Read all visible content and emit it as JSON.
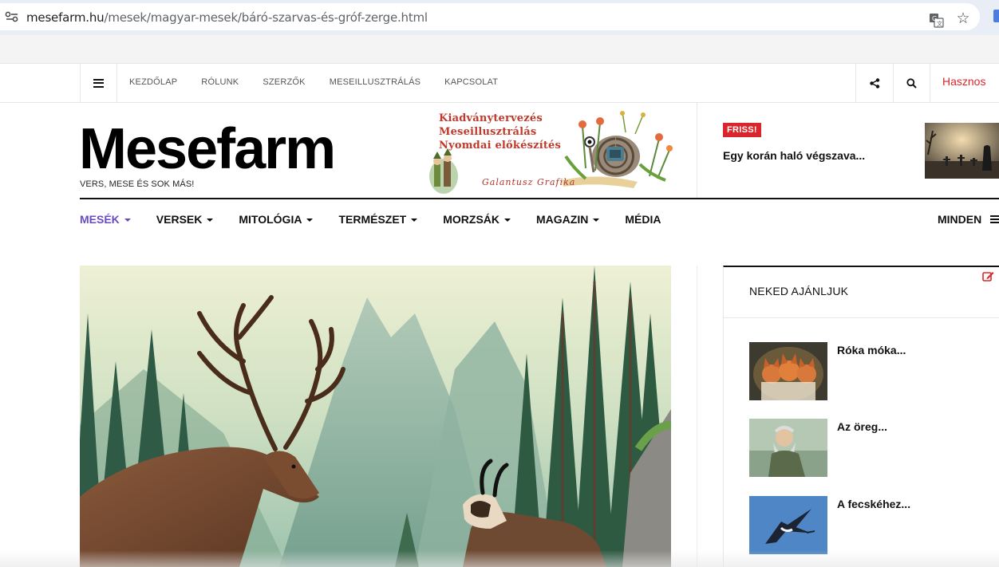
{
  "browser": {
    "url_host": "mesefarm.hu",
    "url_path": "/mesek/magyar-mesek/báró-szarvas-és-gróf-zerge.html",
    "icons": [
      "site-settings-icon",
      "translate-icon",
      "bookmark-star-icon"
    ]
  },
  "topnav": {
    "links": [
      "KEZDŐLAP",
      "RÓLUNK",
      "SZERZŐK",
      "MESEILLUSZTRÁLÁS",
      "KAPCSOLAT"
    ],
    "extra_link": "Hasznos",
    "icons": [
      "menu-icon",
      "share-icon",
      "search-icon"
    ]
  },
  "header": {
    "logo": "Mesefarm",
    "tagline": "VERS, MESE ÉS SOK MÁS!",
    "ad": {
      "lines": [
        "Kiadványtervezés",
        "Meseillusztrálás",
        "Nyomdai előkészítés"
      ],
      "signature": "Galantusz Grafika"
    },
    "friss": {
      "badge": "FRISS!",
      "title": "Egy korán haló végszava..."
    }
  },
  "mainnav": {
    "items": [
      {
        "label": "MESÉK",
        "dropdown": true,
        "active": true
      },
      {
        "label": "VERSEK",
        "dropdown": true,
        "active": false
      },
      {
        "label": "MITOLÓGIA",
        "dropdown": true,
        "active": false
      },
      {
        "label": "TERMÉSZET",
        "dropdown": true,
        "active": false
      },
      {
        "label": "MORZSÁK",
        "dropdown": true,
        "active": false
      },
      {
        "label": "MAGAZIN",
        "dropdown": true,
        "active": false
      },
      {
        "label": "MÉDIA",
        "dropdown": false,
        "active": false
      }
    ],
    "all_label": "MINDEN",
    "active_color": "#6a4bc4"
  },
  "sidebar": {
    "title": "NEKED AJÁNLJUK",
    "items": [
      {
        "title": "Róka móka..."
      },
      {
        "title": "Az öreg..."
      },
      {
        "title": "A fecskéhez..."
      }
    ]
  },
  "colors": {
    "accent_red": "#d8262c",
    "purple": "#6a4bc4"
  }
}
